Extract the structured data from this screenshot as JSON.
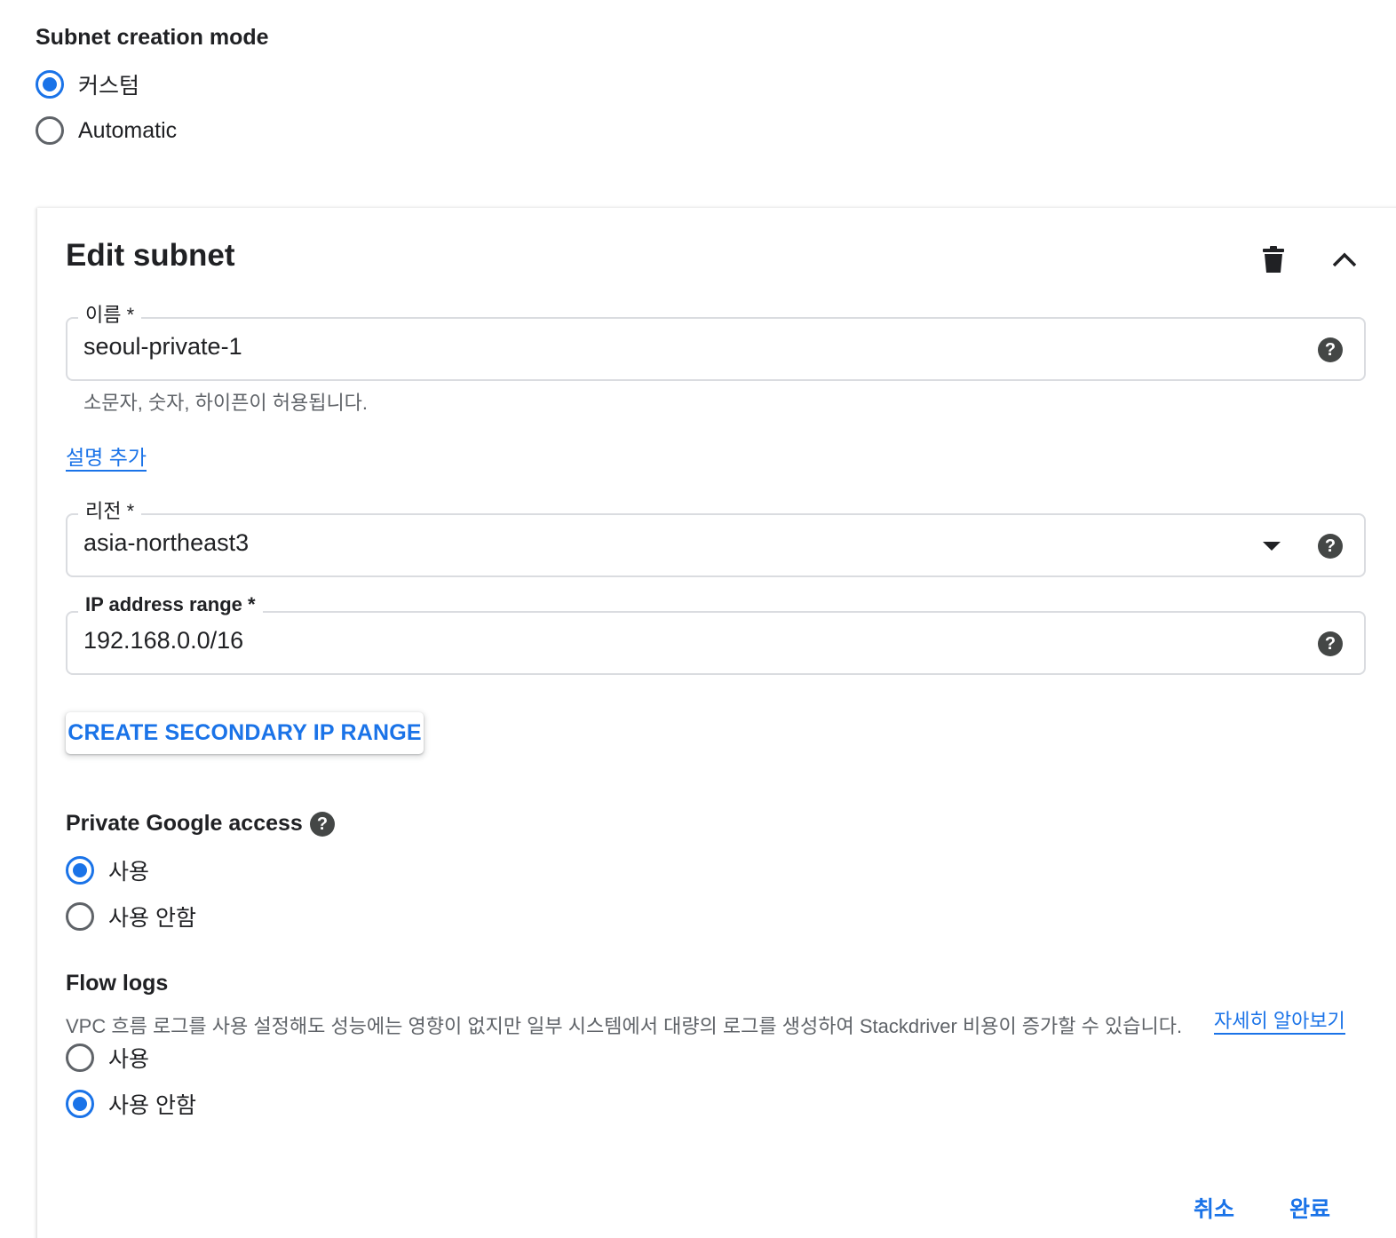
{
  "subnet_creation_mode": {
    "title": "Subnet creation mode",
    "options": [
      {
        "label": "커스텀",
        "checked": true
      },
      {
        "label": "Automatic",
        "checked": false
      }
    ]
  },
  "edit_subnet": {
    "title": "Edit subnet",
    "name_field": {
      "label": "이름 *",
      "value": "seoul-private-1",
      "hint": "소문자, 숫자, 하이픈이 허용됩니다."
    },
    "add_description_link": "설명 추가",
    "region_field": {
      "label": "리전 *",
      "value": "asia-northeast3"
    },
    "ip_range_field": {
      "label": "IP address range *",
      "value": "192.168.0.0/16"
    },
    "create_secondary_button": "CREATE SECONDARY IP RANGE",
    "private_google_access": {
      "title": "Private Google access",
      "options": [
        {
          "label": "사용",
          "checked": true
        },
        {
          "label": "사용 안함",
          "checked": false
        }
      ]
    },
    "flow_logs": {
      "title": "Flow logs",
      "description": "VPC 흐름 로그를 사용 설정해도 성능에는 영향이 없지만 일부 시스템에서 대량의 로그를 생성하여 Stackdriver 비용이 증가할 수 있습니다.",
      "learn_more_link": "자세히 알아보기",
      "options": [
        {
          "label": "사용",
          "checked": false
        },
        {
          "label": "사용 안함",
          "checked": true
        }
      ]
    },
    "actions": {
      "cancel_label": "취소",
      "done_label": "완료"
    }
  },
  "icons": {
    "help": "?",
    "delete": "trash-icon",
    "collapse": "chevron-up-icon",
    "dropdown": "arrow-drop-down-icon"
  },
  "colors": {
    "accent": "#1a73e8",
    "text": "#202124",
    "secondary_text": "#5f6368",
    "border": "#dadce0"
  }
}
